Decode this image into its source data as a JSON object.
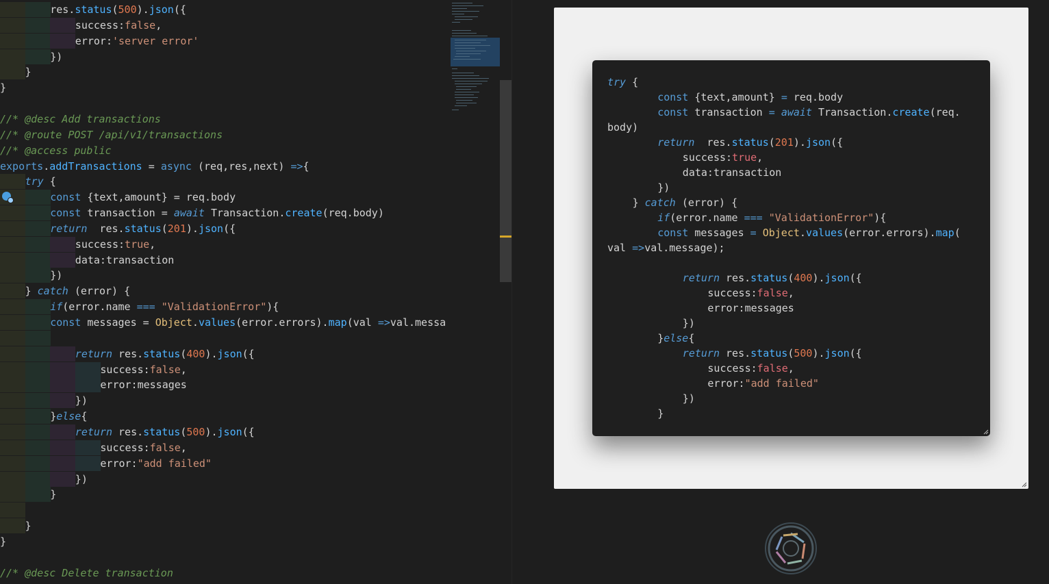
{
  "editor": {
    "lines": [
      {
        "indent": 2,
        "tokens": [
          [
            "w",
            "res."
          ],
          [
            "f",
            "status"
          ],
          [
            "w",
            "("
          ],
          [
            "n",
            "500"
          ],
          [
            "w",
            ")."
          ],
          [
            "f",
            "json"
          ],
          [
            "w",
            "({"
          ]
        ]
      },
      {
        "indent": 3,
        "tokens": [
          [
            "w",
            "success:"
          ],
          [
            "s",
            "false"
          ],
          [
            "w",
            ","
          ]
        ]
      },
      {
        "indent": 3,
        "tokens": [
          [
            "w",
            "error:"
          ],
          [
            "s",
            "'server error'"
          ]
        ]
      },
      {
        "indent": 2,
        "tokens": [
          [
            "w",
            "})"
          ]
        ]
      },
      {
        "indent": 1,
        "tokens": [
          [
            "w",
            "}"
          ]
        ]
      },
      {
        "indent": 0,
        "tokens": [
          [
            "w",
            "}"
          ]
        ]
      },
      {
        "indent": 0,
        "tokens": []
      },
      {
        "indent": 0,
        "tokens": [
          [
            "c",
            "//* @desc Add transactions"
          ]
        ]
      },
      {
        "indent": 0,
        "tokens": [
          [
            "c",
            "//* @route POST /api/v1/transactions"
          ]
        ]
      },
      {
        "indent": 0,
        "tokens": [
          [
            "c",
            "//* @access public"
          ]
        ]
      },
      {
        "indent": 0,
        "tokens": [
          [
            "k",
            "exports"
          ],
          [
            "w",
            "."
          ],
          [
            "f",
            "addTransactions"
          ],
          [
            "w",
            " = "
          ],
          [
            "k",
            "async"
          ],
          [
            "w",
            " (req,res,next) "
          ],
          [
            "k",
            "=>"
          ],
          [
            "w",
            "{"
          ]
        ]
      },
      {
        "indent": 1,
        "tokens": [
          [
            "ki",
            "try"
          ],
          [
            "w",
            " {"
          ]
        ]
      },
      {
        "indent": 2,
        "tokens": [
          [
            "k",
            "const"
          ],
          [
            "w",
            " {text,amount} = req.body"
          ]
        ]
      },
      {
        "indent": 2,
        "tokens": [
          [
            "k",
            "const"
          ],
          [
            "w",
            " transaction = "
          ],
          [
            "ki",
            "await"
          ],
          [
            "w",
            " Transaction."
          ],
          [
            "f",
            "create"
          ],
          [
            "w",
            "(req.body)"
          ]
        ]
      },
      {
        "indent": 2,
        "tokens": [
          [
            "ki",
            "return"
          ],
          [
            "w",
            "  res."
          ],
          [
            "f",
            "status"
          ],
          [
            "w",
            "("
          ],
          [
            "n",
            "201"
          ],
          [
            "w",
            ")."
          ],
          [
            "f",
            "json"
          ],
          [
            "w",
            "({"
          ]
        ]
      },
      {
        "indent": 3,
        "tokens": [
          [
            "w",
            "success:"
          ],
          [
            "s",
            "true"
          ],
          [
            "w",
            ","
          ]
        ]
      },
      {
        "indent": 3,
        "tokens": [
          [
            "w",
            "data:transaction"
          ]
        ]
      },
      {
        "indent": 2,
        "tokens": [
          [
            "w",
            "})"
          ]
        ]
      },
      {
        "indent": 1,
        "tokens": [
          [
            "w",
            "} "
          ],
          [
            "ki",
            "catch"
          ],
          [
            "w",
            " (error) {"
          ]
        ]
      },
      {
        "indent": 2,
        "tokens": [
          [
            "ki",
            "if"
          ],
          [
            "w",
            "(error.name "
          ],
          [
            "k",
            "==="
          ],
          [
            "w",
            " "
          ],
          [
            "s",
            "\"ValidationError\""
          ],
          [
            "w",
            "){"
          ]
        ]
      },
      {
        "indent": 2,
        "tokens": [
          [
            "k",
            "const"
          ],
          [
            "w",
            " messages = "
          ],
          [
            "o",
            "Object"
          ],
          [
            "w",
            "."
          ],
          [
            "f",
            "values"
          ],
          [
            "w",
            "(error.errors)."
          ],
          [
            "f",
            "map"
          ],
          [
            "w",
            "(val "
          ],
          [
            "k",
            "=>"
          ],
          [
            "w",
            "val.message);"
          ]
        ]
      },
      {
        "indent": 2,
        "tokens": []
      },
      {
        "indent": 3,
        "tokens": [
          [
            "ki",
            "return"
          ],
          [
            "w",
            " res."
          ],
          [
            "f",
            "status"
          ],
          [
            "w",
            "("
          ],
          [
            "n",
            "400"
          ],
          [
            "w",
            ")."
          ],
          [
            "f",
            "json"
          ],
          [
            "w",
            "({"
          ]
        ]
      },
      {
        "indent": 4,
        "tokens": [
          [
            "w",
            "success:"
          ],
          [
            "s",
            "false"
          ],
          [
            "w",
            ","
          ]
        ]
      },
      {
        "indent": 4,
        "tokens": [
          [
            "w",
            "error:messages"
          ]
        ]
      },
      {
        "indent": 3,
        "tokens": [
          [
            "w",
            "})"
          ]
        ]
      },
      {
        "indent": 2,
        "tokens": [
          [
            "w",
            "}"
          ],
          [
            "ki",
            "else"
          ],
          [
            "w",
            "{"
          ]
        ]
      },
      {
        "indent": 3,
        "tokens": [
          [
            "ki",
            "return"
          ],
          [
            "w",
            " res."
          ],
          [
            "f",
            "status"
          ],
          [
            "w",
            "("
          ],
          [
            "n",
            "500"
          ],
          [
            "w",
            ")."
          ],
          [
            "f",
            "json"
          ],
          [
            "w",
            "({"
          ]
        ]
      },
      {
        "indent": 4,
        "tokens": [
          [
            "w",
            "success:"
          ],
          [
            "s",
            "false"
          ],
          [
            "w",
            ","
          ]
        ]
      },
      {
        "indent": 4,
        "tokens": [
          [
            "w",
            "error:"
          ],
          [
            "s",
            "\"add failed\""
          ]
        ]
      },
      {
        "indent": 3,
        "tokens": [
          [
            "w",
            "})"
          ]
        ]
      },
      {
        "indent": 2,
        "tokens": [
          [
            "w",
            "}"
          ]
        ]
      },
      {
        "indent": 1,
        "tokens": []
      },
      {
        "indent": 1,
        "tokens": [
          [
            "w",
            "}"
          ]
        ]
      },
      {
        "indent": 0,
        "tokens": [
          [
            "w",
            "}"
          ]
        ]
      },
      {
        "indent": 0,
        "tokens": []
      },
      {
        "indent": 0,
        "tokens": [
          [
            "c",
            "//* @desc Delete transaction"
          ]
        ]
      }
    ]
  },
  "preview": {
    "lines": [
      {
        "indent": 0,
        "tokens": [
          [
            "ki",
            "try"
          ],
          [
            "w",
            " {"
          ]
        ]
      },
      {
        "indent": 2,
        "tokens": [
          [
            "k",
            "const"
          ],
          [
            "w",
            " {text,amount} "
          ],
          [
            "k",
            "="
          ],
          [
            "w",
            " req.body"
          ]
        ]
      },
      {
        "indent": 2,
        "tokens": [
          [
            "k",
            "const"
          ],
          [
            "w",
            " transaction "
          ],
          [
            "k",
            "="
          ],
          [
            "w",
            " "
          ],
          [
            "ki",
            "await"
          ],
          [
            "w",
            " Transaction."
          ],
          [
            "f",
            "create"
          ],
          [
            "w",
            "(req."
          ]
        ]
      },
      {
        "indent": 0,
        "tokens": [
          [
            "w",
            "body)"
          ]
        ]
      },
      {
        "indent": 2,
        "tokens": [
          [
            "ki",
            "return"
          ],
          [
            "w",
            "  res."
          ],
          [
            "f",
            "status"
          ],
          [
            "w",
            "("
          ],
          [
            "n",
            "201"
          ],
          [
            "w",
            ")."
          ],
          [
            "f",
            "json"
          ],
          [
            "w",
            "({"
          ]
        ]
      },
      {
        "indent": 3,
        "tokens": [
          [
            "w",
            "success:"
          ],
          [
            "kw",
            "true"
          ],
          [
            "w",
            ","
          ]
        ]
      },
      {
        "indent": 3,
        "tokens": [
          [
            "w",
            "data:transaction"
          ]
        ]
      },
      {
        "indent": 2,
        "tokens": [
          [
            "w",
            "})"
          ]
        ]
      },
      {
        "indent": 1,
        "tokens": [
          [
            "w",
            "} "
          ],
          [
            "ki",
            "catch"
          ],
          [
            "w",
            " (error) {"
          ]
        ]
      },
      {
        "indent": 2,
        "tokens": [
          [
            "ki",
            "if"
          ],
          [
            "w",
            "(error.name "
          ],
          [
            "k",
            "==="
          ],
          [
            "w",
            " "
          ],
          [
            "s",
            "\"ValidationError\""
          ],
          [
            "w",
            "){"
          ]
        ]
      },
      {
        "indent": 2,
        "tokens": [
          [
            "k",
            "const"
          ],
          [
            "w",
            " messages "
          ],
          [
            "k",
            "="
          ],
          [
            "w",
            " "
          ],
          [
            "o",
            "Object"
          ],
          [
            "w",
            "."
          ],
          [
            "f",
            "values"
          ],
          [
            "w",
            "(error.errors)."
          ],
          [
            "f",
            "map"
          ],
          [
            "w",
            "("
          ]
        ]
      },
      {
        "indent": 0,
        "tokens": [
          [
            "w",
            "val "
          ],
          [
            "k",
            "=>"
          ],
          [
            "w",
            "val.message);"
          ]
        ]
      },
      {
        "indent": 0,
        "tokens": []
      },
      {
        "indent": 3,
        "tokens": [
          [
            "ki",
            "return"
          ],
          [
            "w",
            " res."
          ],
          [
            "f",
            "status"
          ],
          [
            "w",
            "("
          ],
          [
            "n",
            "400"
          ],
          [
            "w",
            ")."
          ],
          [
            "f",
            "json"
          ],
          [
            "w",
            "({"
          ]
        ]
      },
      {
        "indent": 4,
        "tokens": [
          [
            "w",
            "success:"
          ],
          [
            "kw",
            "false"
          ],
          [
            "w",
            ","
          ]
        ]
      },
      {
        "indent": 4,
        "tokens": [
          [
            "w",
            "error:messages"
          ]
        ]
      },
      {
        "indent": 3,
        "tokens": [
          [
            "w",
            "})"
          ]
        ]
      },
      {
        "indent": 2,
        "tokens": [
          [
            "w",
            "}"
          ],
          [
            "ki",
            "else"
          ],
          [
            "w",
            "{"
          ]
        ]
      },
      {
        "indent": 3,
        "tokens": [
          [
            "ki",
            "return"
          ],
          [
            "w",
            " res."
          ],
          [
            "f",
            "status"
          ],
          [
            "w",
            "("
          ],
          [
            "n",
            "500"
          ],
          [
            "w",
            ")."
          ],
          [
            "f",
            "json"
          ],
          [
            "w",
            "({"
          ]
        ]
      },
      {
        "indent": 4,
        "tokens": [
          [
            "w",
            "success:"
          ],
          [
            "kw",
            "false"
          ],
          [
            "w",
            ","
          ]
        ]
      },
      {
        "indent": 4,
        "tokens": [
          [
            "w",
            "error:"
          ],
          [
            "s",
            "\"add failed\""
          ]
        ]
      },
      {
        "indent": 3,
        "tokens": [
          [
            "w",
            "})"
          ]
        ]
      },
      {
        "indent": 2,
        "tokens": [
          [
            "w",
            "}"
          ]
        ]
      }
    ]
  },
  "icons": {
    "cursor": "lightbulb-marker-icon",
    "logo": "aperture-logo-icon",
    "resize": "resize-handle-icon"
  },
  "colors": {
    "editor_bg": "#1e1e1e",
    "panel_bg": "#f0f0f0",
    "card_bg": "#1f1f1f",
    "keyword": "#569cd6",
    "function": "#4fb3ff",
    "string": "#ce9178",
    "number": "#e07850",
    "comment": "#6a9955",
    "scroll_marker": "#d7a72a"
  }
}
